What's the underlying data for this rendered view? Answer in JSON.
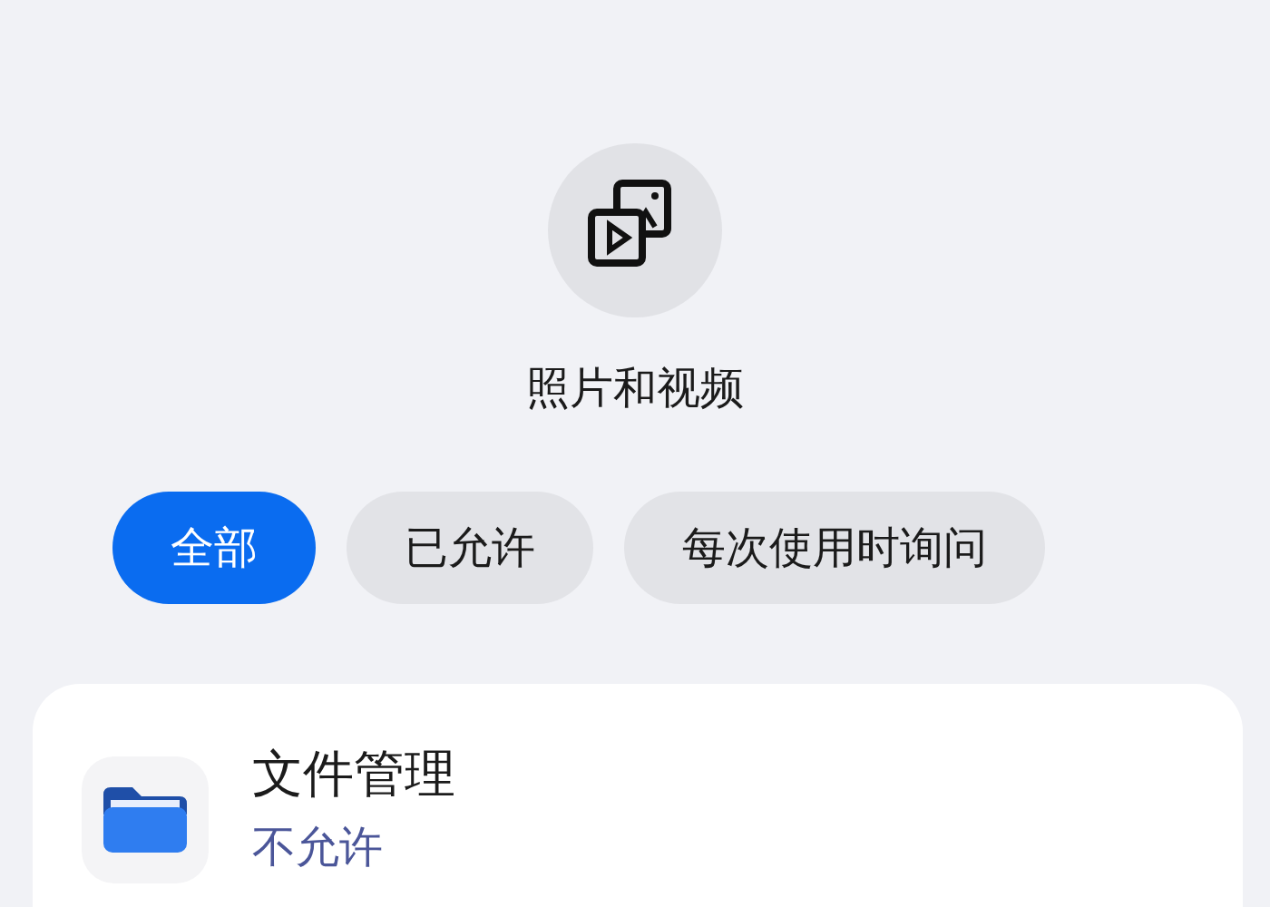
{
  "header": {
    "title": "照片和视频"
  },
  "filters": [
    {
      "label": "全部",
      "selected": true
    },
    {
      "label": "已允许",
      "selected": false
    },
    {
      "label": "每次使用时询问",
      "selected": false
    }
  ],
  "apps": [
    {
      "name": "文件管理",
      "status": "不允许"
    }
  ]
}
